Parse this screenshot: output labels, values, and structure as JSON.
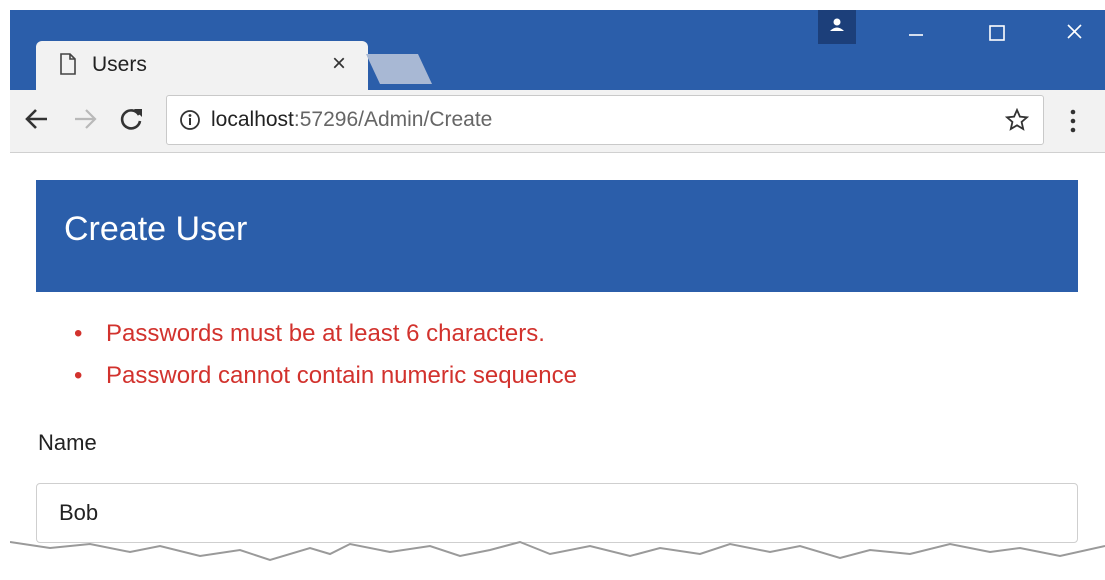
{
  "browser": {
    "tab": {
      "title": "Users",
      "close_glyph": "×"
    },
    "window_controls": [
      "profile-icon",
      "minimize-icon",
      "maximize-icon",
      "close-icon"
    ],
    "address_bar": {
      "host": "localhost",
      "path": ":57296/Admin/Create"
    },
    "icons": [
      "back-icon",
      "forward-icon",
      "reload-icon",
      "info-icon",
      "star-icon",
      "menu-icon"
    ]
  },
  "page": {
    "title": "Create User",
    "errors": [
      "Passwords must be at least 6 characters.",
      "Password cannot contain numeric sequence"
    ],
    "form": {
      "name_label": "Name",
      "name_value": "Bob"
    }
  },
  "colors": {
    "chrome_blue": "#2b5eaa",
    "header_blue": "#2b5eaa",
    "error_red": "#d2322d",
    "toolbar_gray": "#f2f2f2"
  }
}
